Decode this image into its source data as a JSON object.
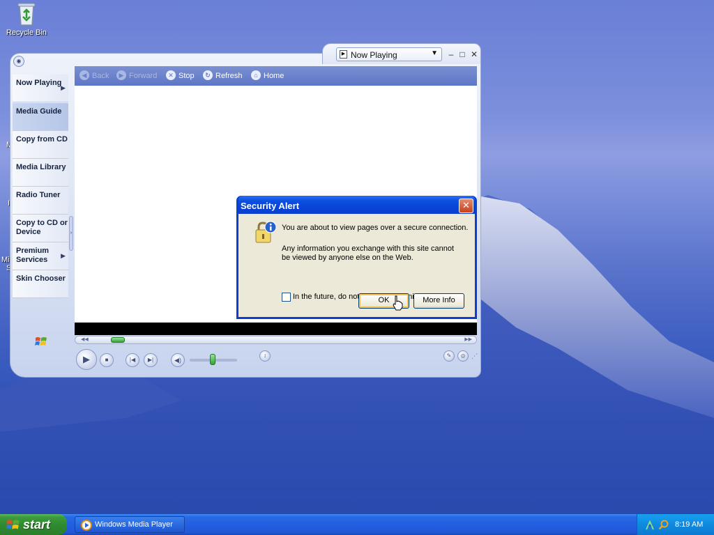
{
  "desktop": {
    "icons": [
      {
        "label": "Recycle Bin",
        "icon": "recycle-bin-icon"
      }
    ],
    "edge_fragments": [
      "M",
      "I",
      "Mic",
      "S"
    ]
  },
  "wmp": {
    "view_selector": {
      "value": "Now Playing",
      "icon": "now-playing-icon"
    },
    "window_controls": {
      "minimize": "–",
      "maximize": "□",
      "close": "✕"
    },
    "menu_toggle": "◉",
    "nav": [
      {
        "label": "Now Playing",
        "selected": false,
        "chevron": true
      },
      {
        "label": "Media Guide",
        "selected": true,
        "chevron": false
      },
      {
        "label": "Copy from CD",
        "selected": false,
        "chevron": false
      },
      {
        "label": "Media Library",
        "selected": false,
        "chevron": false
      },
      {
        "label": "Radio Tuner",
        "selected": false,
        "chevron": false
      },
      {
        "label": "Copy to CD or Device",
        "selected": false,
        "chevron": false
      },
      {
        "label": "Premium Services",
        "selected": false,
        "chevron": true
      },
      {
        "label": "Skin Chooser",
        "selected": false,
        "chevron": false
      }
    ],
    "browser_bar": {
      "back": "Back",
      "forward": "Forward",
      "stop": "Stop",
      "refresh": "Refresh",
      "home": "Home"
    },
    "seek_position": 0.06,
    "volume_level": 0.42
  },
  "dialog": {
    "title": "Security Alert",
    "message_1": "You are about to view pages over a secure connection.",
    "message_2": "Any information you exchange with this site cannot be viewed by anyone else on the Web.",
    "checkbox_label": "In the future, do not show this warning",
    "checkbox_checked": false,
    "ok_label": "OK",
    "more_info_label": "More Info",
    "close_glyph": "✕"
  },
  "taskbar": {
    "start_label": "start",
    "tasks": [
      {
        "label": "Windows Media Player",
        "icon": "wmp-icon"
      }
    ],
    "clock": "8:19 AM"
  },
  "colors": {
    "xp_blue_title": "#0842d6",
    "start_green": "#3c9a3c",
    "dialog_face": "#ece9d8",
    "wmp_browse_bar": "#6a80cc"
  }
}
